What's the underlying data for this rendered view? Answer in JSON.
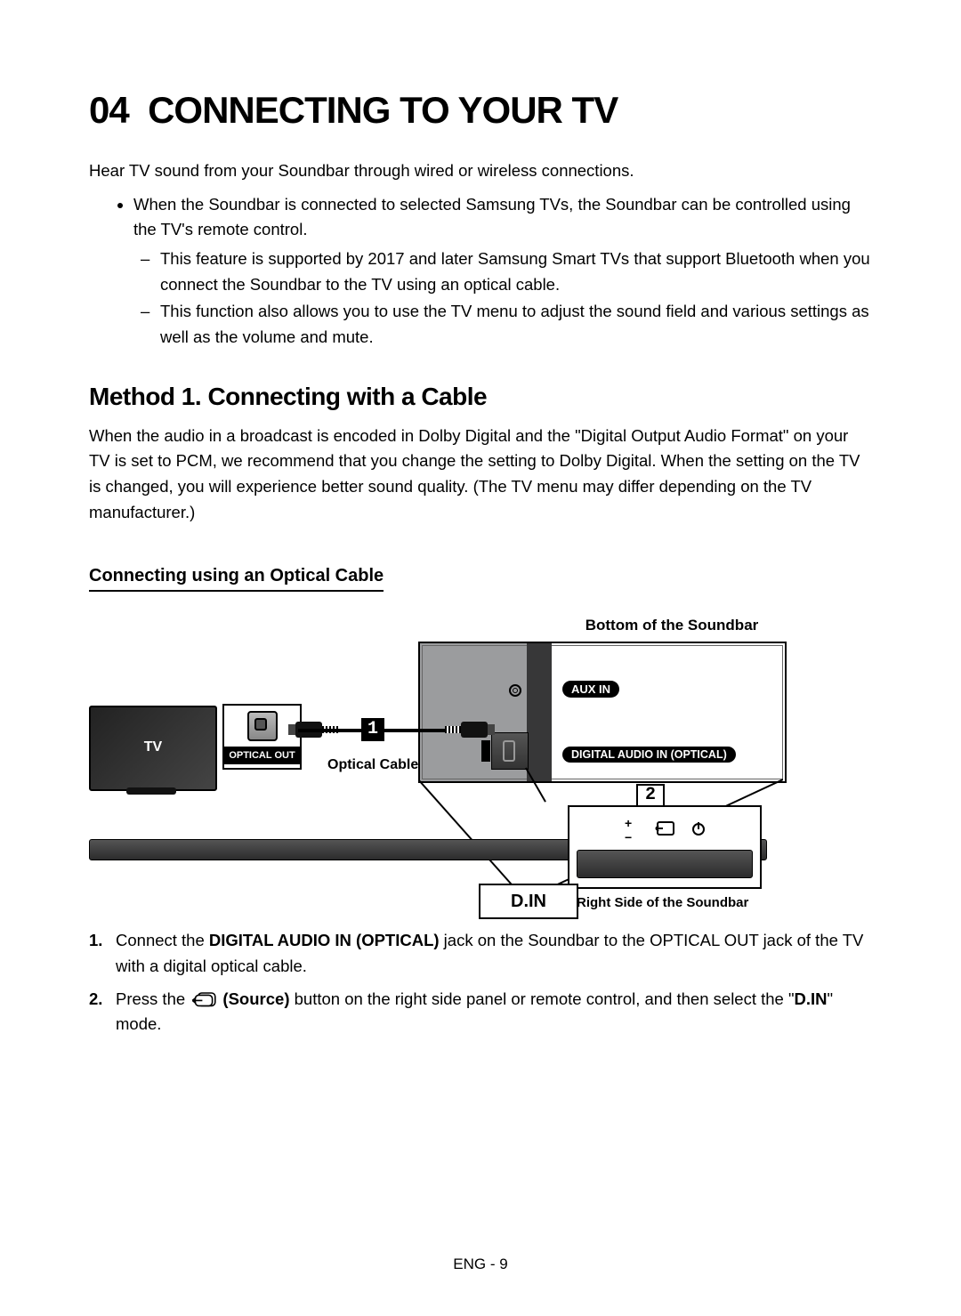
{
  "section_number": "04",
  "section_title": "CONNECTING TO YOUR TV",
  "intro": "Hear TV sound from your Soundbar through wired or wireless connections.",
  "bullet1": "When the Soundbar is connected to selected Samsung TVs, the Soundbar can be controlled using the TV's remote control.",
  "dash1": "This feature is supported by 2017 and later Samsung Smart TVs that support Bluetooth when you connect the Soundbar to the TV using an optical cable.",
  "dash2": "This function also allows you to use the TV menu to adjust the sound field and various settings as well as the volume and mute.",
  "method1_heading": "Method 1. Connecting with a Cable",
  "method1_para": "When the audio in a broadcast is encoded in Dolby Digital and the \"Digital Output Audio Format\" on your TV is set to PCM, we recommend that you change the setting to Dolby Digital. When the setting on the TV is changed, you will experience better sound quality. (The TV menu may differ depending on the TV manufacturer.)",
  "sub_heading": "Connecting using an Optical Cable",
  "diagram": {
    "top_label": "Bottom of the Soundbar",
    "tv_label": "TV",
    "optical_out": "OPTICAL OUT",
    "optical_cable": "Optical Cable",
    "aux_in": "AUX IN",
    "digital_audio_in": "DIGITAL AUDIO IN (OPTICAL)",
    "callout1": "1",
    "callout2": "2",
    "din": "D.IN",
    "right_label": "Right Side of the Soundbar"
  },
  "step1_pre": "Connect the ",
  "step1_bold": "DIGITAL AUDIO IN (OPTICAL)",
  "step1_post": " jack on the Soundbar to the OPTICAL OUT jack of the TV with a digital optical cable.",
  "step2_pre": "Press the ",
  "step2_bold": " (Source)",
  "step2_mid": " button on the right side panel or remote control, and then select the \"",
  "step2_bold2": "D.IN",
  "step2_post": "\" mode.",
  "footer": "ENG - 9"
}
